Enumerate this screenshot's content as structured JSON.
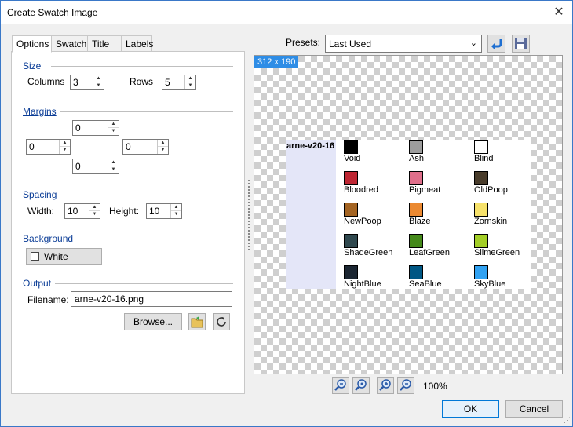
{
  "window": {
    "title": "Create Swatch Image"
  },
  "tabs": [
    "Options",
    "Swatch",
    "Title",
    "Labels"
  ],
  "options": {
    "size": {
      "label": "Size",
      "columns_label": "Columns",
      "columns": "3",
      "rows_label": "Rows",
      "rows": "5"
    },
    "margins": {
      "label": "Margins",
      "top": "0",
      "left": "0",
      "right": "0",
      "bottom": "0"
    },
    "spacing": {
      "label": "Spacing",
      "width_label": "Width:",
      "width": "10",
      "height_label": "Height:",
      "height": "10"
    },
    "background": {
      "label": "Background",
      "value": "White"
    },
    "output": {
      "label": "Output",
      "filename_label": "Filename:",
      "filename": "arne-v20-16.png",
      "browse_label": "Browse..."
    }
  },
  "presets": {
    "label": "Presets:",
    "value": "Last Used"
  },
  "preview": {
    "dimensions": "312 x 190",
    "title": "arne-v20-16",
    "swatches": [
      {
        "name": "Void",
        "color": "#000000"
      },
      {
        "name": "Ash",
        "color": "#9d9d9d"
      },
      {
        "name": "Blind",
        "color": "#ffffff"
      },
      {
        "name": "Bloodred",
        "color": "#be2633"
      },
      {
        "name": "Pigmeat",
        "color": "#e06f8b"
      },
      {
        "name": "OldPoop",
        "color": "#493c2b"
      },
      {
        "name": "NewPoop",
        "color": "#a46422"
      },
      {
        "name": "Blaze",
        "color": "#eb8931"
      },
      {
        "name": "Zornskin",
        "color": "#f7e26b"
      },
      {
        "name": "ShadeGreen",
        "color": "#2f484e"
      },
      {
        "name": "LeafGreen",
        "color": "#44891a"
      },
      {
        "name": "SlimeGreen",
        "color": "#a3ce27"
      },
      {
        "name": "NightBlue",
        "color": "#1b2632"
      },
      {
        "name": "SeaBlue",
        "color": "#005784"
      },
      {
        "name": "SkyBlue",
        "color": "#31a2f2"
      }
    ]
  },
  "zoom": {
    "level": "100%"
  },
  "footer": {
    "ok_label": "OK",
    "cancel_label": "Cancel"
  },
  "colors": {
    "accent": "#0a3c96",
    "tag": "#2e8de6"
  }
}
